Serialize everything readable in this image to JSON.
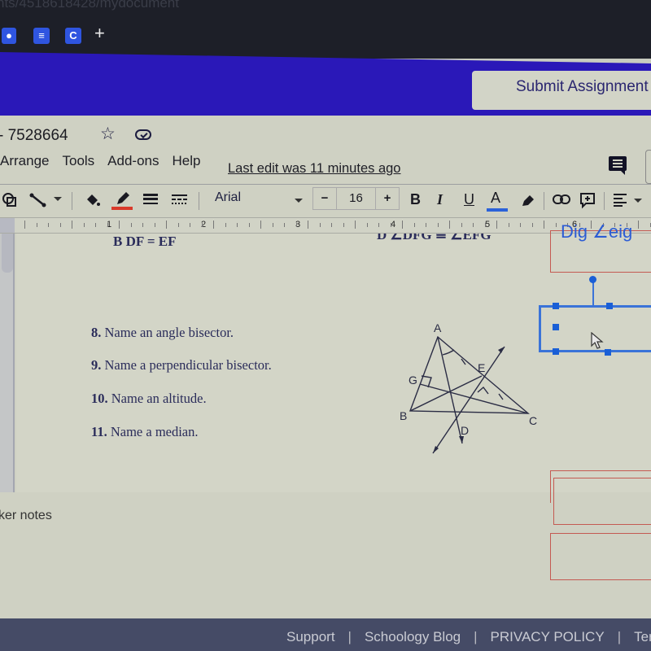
{
  "browser": {
    "url_fragment": "nts/4518618428/mydocument",
    "bookmarks": [
      {
        "icon": "person-icon",
        "glyph": "♟"
      },
      {
        "icon": "docs-icon",
        "glyph": "≡"
      },
      {
        "icon": "c-app-icon",
        "glyph": "C"
      },
      {
        "icon": "plus-icon",
        "glyph": "+"
      }
    ]
  },
  "schoology": {
    "submit_label": "Submit Assignment",
    "bar_color": "#2a18b8"
  },
  "docs": {
    "title": "- 7528664",
    "star_glyph": "☆",
    "menu": [
      "Arrange",
      "Tools",
      "Add-ons",
      "Help"
    ],
    "last_edit": "Last edit was 11 minutes ago",
    "toolbar": {
      "font": "Arial",
      "font_size": "16",
      "minus": "−",
      "plus": "+",
      "bold": "B",
      "italic": "I",
      "underline": "U",
      "text_color": "A"
    },
    "ruler_numbers": [
      "1",
      "2",
      "3",
      "4",
      "5",
      "6"
    ],
    "speaker_notes": "ker notes"
  },
  "slide": {
    "top_left_text": "B DF = EF",
    "top_mid_text": "D ∠DFG ≅ ∠EFG",
    "questions": [
      {
        "num": "8.",
        "text": " Name an angle bisector."
      },
      {
        "num": "9.",
        "text": " Name a perpendicular bisector."
      },
      {
        "num": "10.",
        "text": " Name an altitude."
      },
      {
        "num": "11.",
        "text": " Name a median."
      }
    ],
    "diagram_labels": {
      "A": "A",
      "B": "B",
      "C": "C",
      "D": "D",
      "E": "E",
      "G": "G"
    },
    "answer_box_text": "Dig ∠eig"
  },
  "footer": {
    "links": [
      "Support",
      "Schoology Blog",
      "PRIVACY POLICY",
      "Ter"
    ]
  }
}
